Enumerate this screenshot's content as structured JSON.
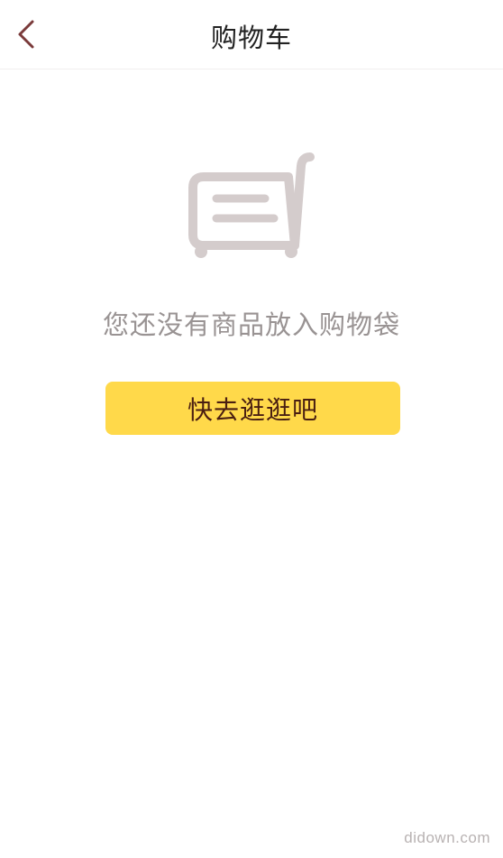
{
  "header": {
    "title": "购物车",
    "back_icon": "chevron-left-icon"
  },
  "empty_state": {
    "icon": "shopping-cart-icon",
    "message": "您还没有商品放入购物袋",
    "button_label": "快去逛逛吧"
  },
  "watermark": "didown.com",
  "colors": {
    "accent": "#ffd94a",
    "back_icon": "#7a3a3a",
    "cart_icon": "#d4cccc",
    "message_text": "#999393"
  }
}
